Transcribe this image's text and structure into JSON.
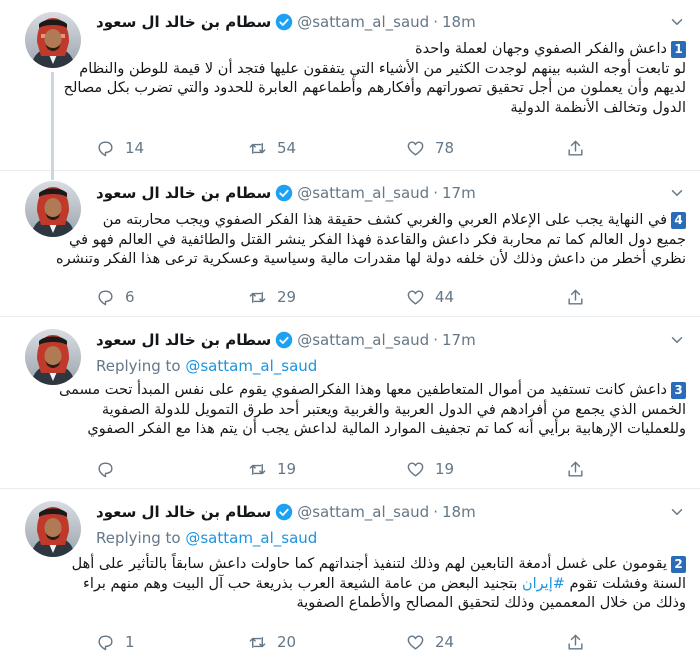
{
  "tweets": [
    {
      "name": "سطام بن خالد ال سعود",
      "handle": "@sattam_al_saud",
      "time": "18m",
      "number": "1",
      "lines": [
        "داعش والفكر الصفوي وجهان لعملة واحدة",
        "لو تابعت أوجه الشبه بينهم لوجدت الكثير من الأشياء التي يتفقون عليها فتجد أن لا قيمة للوطن والنظام",
        "لديهم وأن يعملون من أجل تحقيق تصوراتهم وأفكارهم وأطماعهم العابرة للحدود والتي تضرب بكل مصالح",
        "الدول وتخالف الأنظمة الدولية"
      ],
      "replies": "14",
      "retweets": "54",
      "likes": "78"
    },
    {
      "name": "سطام بن خالد ال سعود",
      "handle": "@sattam_al_saud",
      "time": "17m",
      "number": "4",
      "lines": [
        "في النهاية يجب على الإعلام العربي والغربي كشف حقيقة هذا الفكر الصفوي ويجب محاربته من",
        "جميع دول العالم كما تم محاربة فكر داعش والقاعدة فهذا الفكر ينشر القتل والطائفية في العالم فهو في",
        "نظري أخطر من داعش وذلك لأن خلفه دولة لها مقدرات مالية وسياسية وعسكرية ترعى هذا الفكر وتنشره"
      ],
      "replies": "6",
      "retweets": "29",
      "likes": "44"
    },
    {
      "name": "سطام بن خالد ال سعود",
      "handle": "@sattam_al_saud",
      "time": "17m",
      "replying_label": "Replying to",
      "replying_to": "@sattam_al_saud",
      "number": "3",
      "lines": [
        "داعش كانت تستفيد من أموال المتعاطفين معها وهذا الفكرالصفوي يقوم على نفس المبدأ تحت مسمى",
        "الخمس الذي يجمع من أفرادهم في الدول العربية والغربية ويعتبر أحد طرق التمويل للدولة الصفوية",
        "وللعمليات الإرهابية برأيي أنه كما تم تجفيف الموارد المالية لداعش يجب أن يتم هذا مع الفكر الصفوي"
      ],
      "replies": "",
      "retweets": "19",
      "likes": "19"
    },
    {
      "name": "سطام بن خالد ال سعود",
      "handle": "@sattam_al_saud",
      "time": "18m",
      "replying_label": "Replying to",
      "replying_to": "@sattam_al_saud",
      "number": "2",
      "line1": "يقومون على غسل أدمغة التابعين لهم وذلك لتنفيذ أجنداتهم كما حاولت داعش سابقاً بالتأثير على أهل",
      "line2_before": "السنة وفشلت تقوم ",
      "hashtag": "#إيران",
      "line2_after": " بتجنيد البعض من عامة الشيعة العرب بذريعة حب آل البيت وهم منهم براء",
      "line3": "وذلك من خلال المعممين وذلك لتحقيق المصالح والأطماع الصفوية",
      "replies": "1",
      "retweets": "20",
      "likes": "24"
    }
  ]
}
